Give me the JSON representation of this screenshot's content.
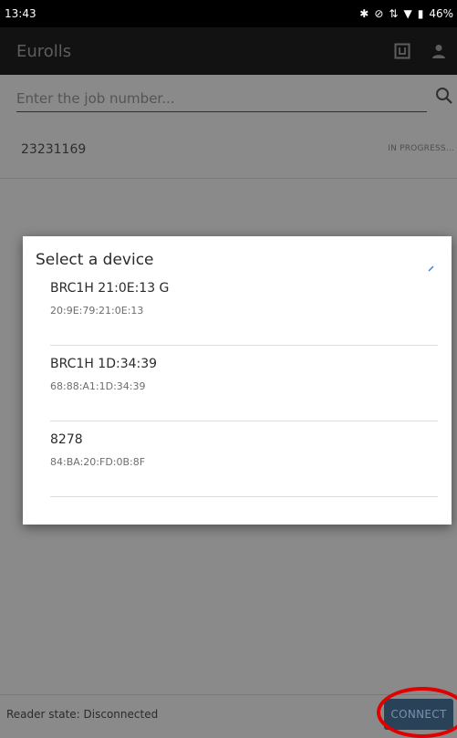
{
  "status_bar": {
    "time": "13:43",
    "icons": [
      "bluetooth-icon",
      "mute-icon",
      "signal-icon",
      "wifi-icon",
      "battery-icon"
    ],
    "battery": "46%"
  },
  "app_bar": {
    "title": "Eurolls",
    "actions": [
      "nfc-icon",
      "person-icon"
    ]
  },
  "search": {
    "placeholder": "Enter the job number..."
  },
  "job": {
    "number": "23231169",
    "status": "IN PROGRESS..."
  },
  "dialog": {
    "title": "Select a device",
    "devices": [
      {
        "name": "BRC1H 21:0E:13 G",
        "address": "20:9E:79:21:0E:13"
      },
      {
        "name": "BRC1H 1D:34:39",
        "address": "68:88:A1:1D:34:39"
      },
      {
        "name": "8278",
        "address": "84:BA:20:FD:0B:8F"
      }
    ]
  },
  "bottom_bar": {
    "reader_state": "Reader state: Disconnected",
    "connect_label": "CONNECT"
  },
  "colors": {
    "dim_background": "#8a8a8a",
    "app_bar": "#121212",
    "connect_button": "#2a4257",
    "annotation": "#e00000"
  }
}
